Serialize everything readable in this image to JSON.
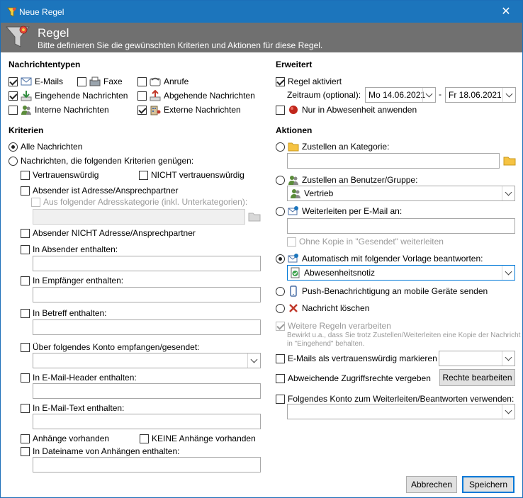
{
  "window": {
    "title": "Neue Regel",
    "close_glyph": "✕"
  },
  "banner": {
    "title": "Regel",
    "subtitle": "Bitte definieren Sie die gewünschten Kriterien und Aktionen für diese Regel."
  },
  "message_types": {
    "header": "Nachrichtentypen",
    "emails": "E-Mails",
    "faxe": "Faxe",
    "anrufe": "Anrufe",
    "incoming": "Eingehende Nachrichten",
    "outgoing": "Abgehende Nachrichten",
    "internal": "Interne Nachrichten",
    "external": "Externe Nachrichten"
  },
  "criteria": {
    "header": "Kriterien",
    "all": "Alle Nachrichten",
    "match": "Nachrichten, die folgenden Kriterien genügen:",
    "trusted": "Vertrauenswürdig",
    "not_trusted": "NICHT vertrauenswürdig",
    "sender_is_contact": "Absender ist Adresse/Ansprechpartner",
    "from_category": "Aus folgender Adresskategorie (inkl. Unterkategorien):",
    "sender_not_contact": "Absender NICHT Adresse/Ansprechpartner",
    "in_sender": "In Absender enthalten:",
    "in_recipient": "In Empfänger enthalten:",
    "in_subject": "In Betreff enthalten:",
    "via_account": "Über folgendes Konto empfangen/gesendet:",
    "in_header": "In E-Mail-Header enthalten:",
    "in_text": "In E-Mail-Text enthalten:",
    "has_attachments": "Anhänge vorhanden",
    "no_attachments": "KEINE Anhänge vorhanden",
    "in_attachment_name": "In Dateiname von Anhängen enthalten:"
  },
  "advanced": {
    "header": "Erweitert",
    "active": "Regel aktiviert",
    "period_label": "Zeitraum (optional):",
    "date_from": "Mo 14.06.2021",
    "date_sep": "-",
    "date_to": "Fr 18.06.2021",
    "only_absence": "Nur in Abwesenheit anwenden"
  },
  "actions": {
    "header": "Aktionen",
    "to_category": "Zustellen an Kategorie:",
    "to_user": "Zustellen an Benutzer/Gruppe:",
    "user_value": "Vertrieb",
    "forward_email": "Weiterleiten per E-Mail an:",
    "no_copy": "Ohne Kopie in \"Gesendet\" weiterleiten",
    "auto_reply": "Automatisch mit folgender Vorlage beantworten:",
    "template_value": "Abwesenheitsnotiz",
    "push": "Push-Benachrichtigung an mobile Geräte senden",
    "delete": "Nachricht löschen",
    "more_rules": "Weitere Regeln verarbeiten",
    "more_rules_note1": "Bewirkt u.a., dass Sie trotz Zustellen/Weiterleiten eine Kopie der Nachricht",
    "more_rules_note2": "in \"Eingehend\" behalten.",
    "mark_trusted": "E-Mails als vertrauenswürdig markieren",
    "access_rights": "Abweichende Zugriffsrechte vergeben",
    "edit_rights": "Rechte bearbeiten",
    "use_account": "Folgendes Konto zum Weiterleiten/Beantworten verwenden:"
  },
  "footer": {
    "cancel": "Abbrechen",
    "save": "Speichern"
  },
  "colors": {
    "titlebar": "#1c75bc",
    "banner": "#707070",
    "accent": "#0078d7"
  }
}
